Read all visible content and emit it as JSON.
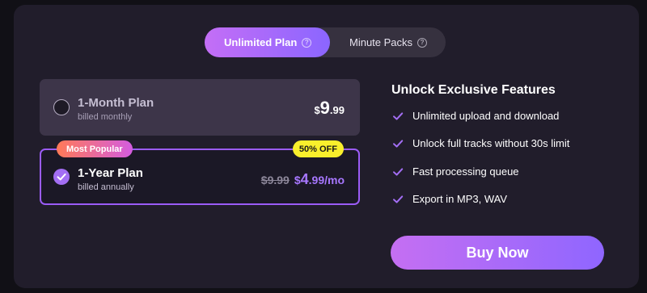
{
  "tabs": {
    "active": "Unlimited Plan",
    "inactive": "Minute Packs",
    "help_glyph": "?"
  },
  "plans": [
    {
      "name": "1-Month Plan",
      "billing": "billed monthly",
      "currency": "$",
      "price_main": "9",
      "price_cents": ".99",
      "selected": false
    },
    {
      "name": "1-Year Plan",
      "billing": "billed annually",
      "badge_popular": "Most Popular",
      "badge_discount": "50% OFF",
      "old_price": "$9.99",
      "currency": "$",
      "price_main": "4",
      "price_cents": ".99/mo",
      "selected": true
    }
  ],
  "features": {
    "title": "Unlock Exclusive Features",
    "items": [
      "Unlimited upload and download",
      "Unlock full tracks without 30s limit",
      "Fast processing queue",
      "Export in MP3, WAV"
    ]
  },
  "buy": {
    "label": "Buy Now"
  },
  "colors": {
    "accent": "#9b5cf6",
    "check": "#a36ef4",
    "discount_badge": "#f9ef2c"
  },
  "icons": {
    "help": "help-circle-icon",
    "radio": "radio-empty-icon",
    "selected": "check-circle-icon",
    "feature": "check-icon"
  }
}
